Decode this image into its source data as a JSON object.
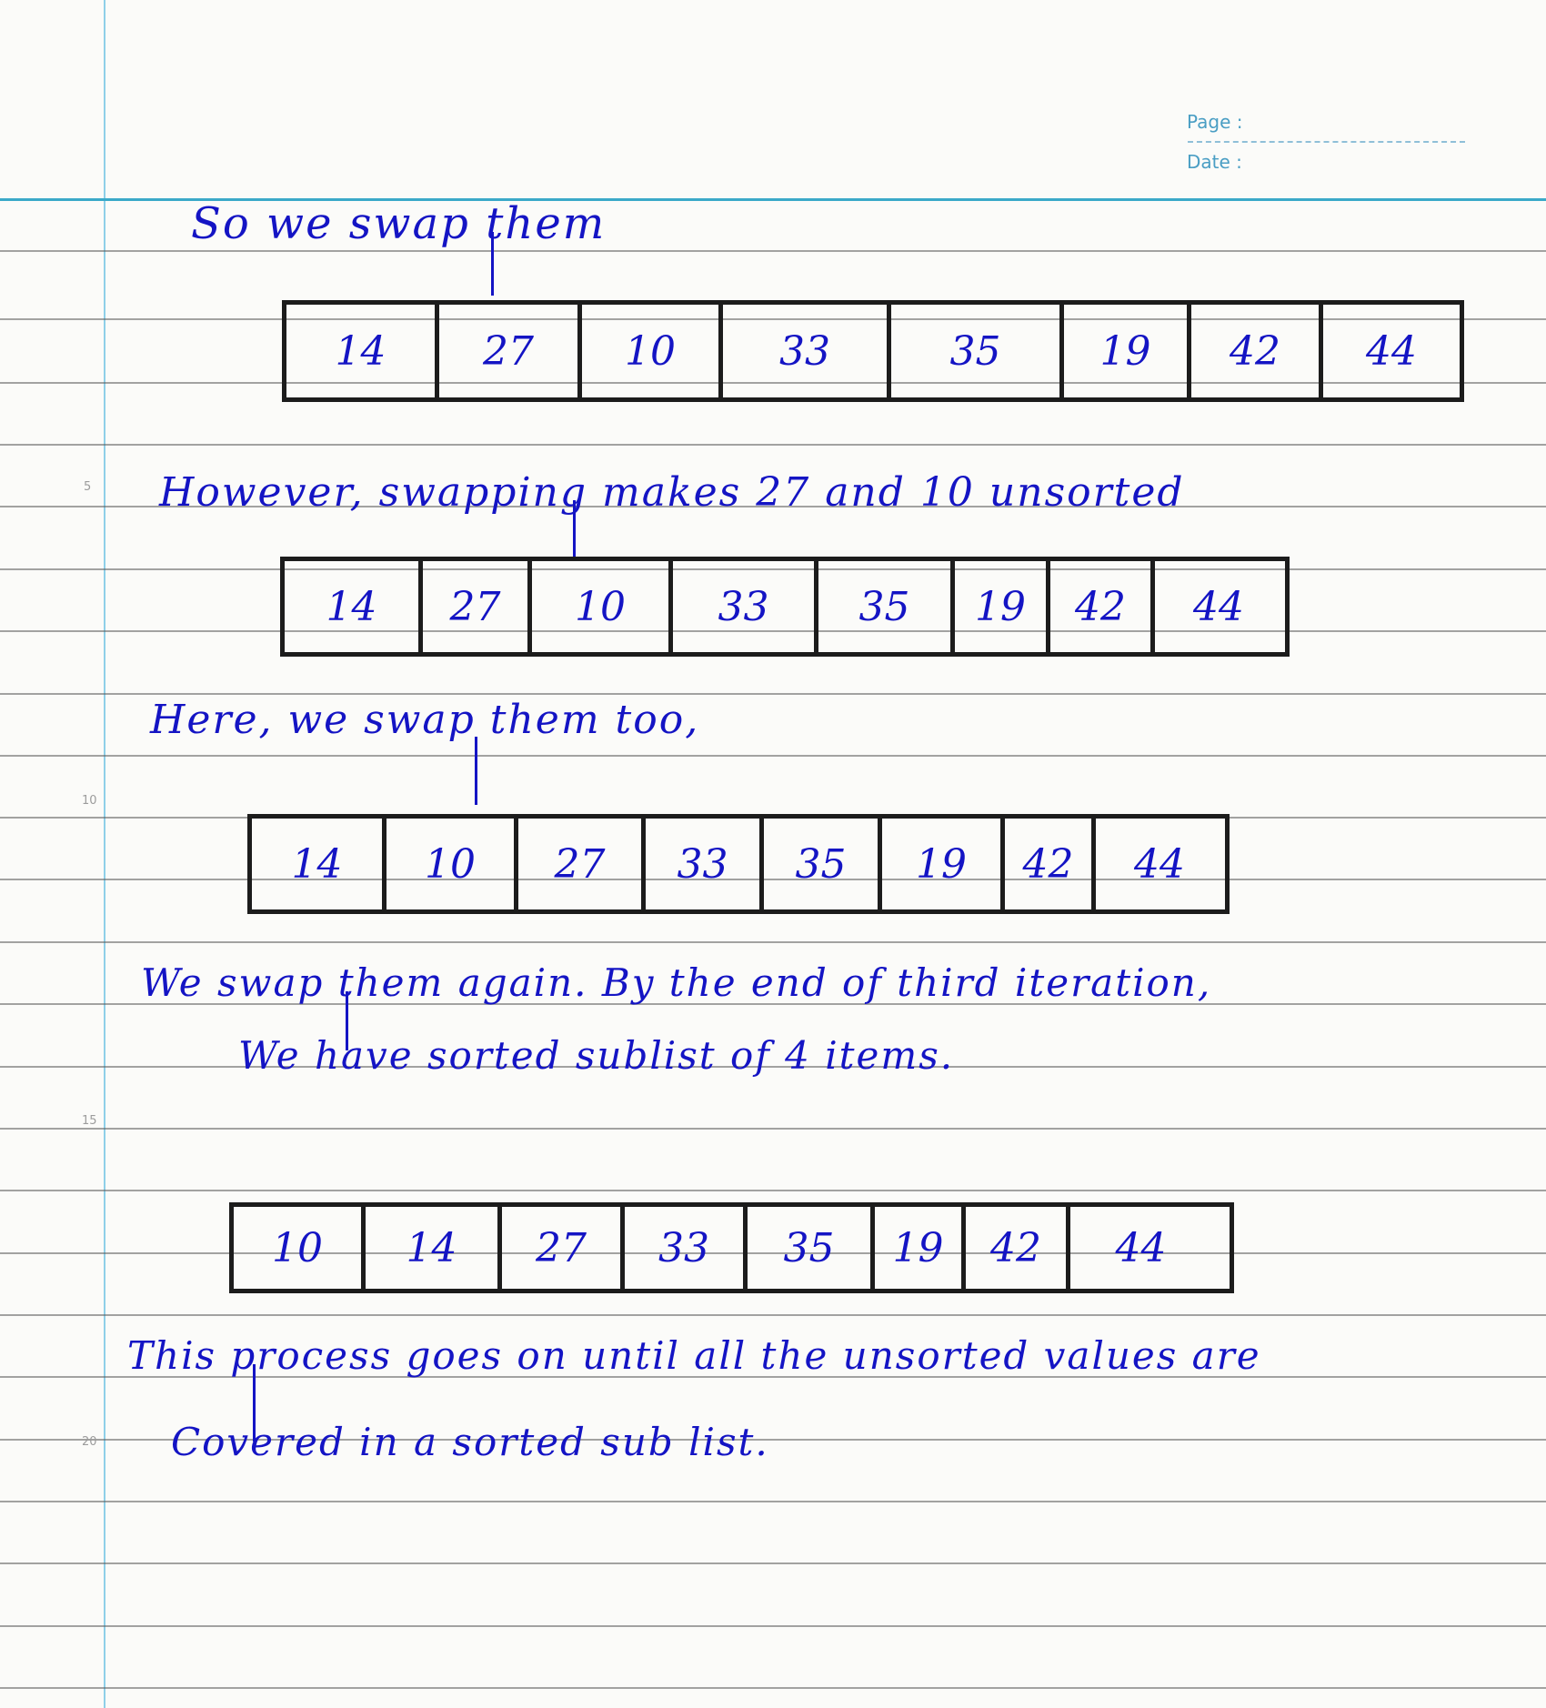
{
  "header": {
    "page_label": "Page :",
    "date_label": "Date :"
  },
  "margin_numbers": [
    "5",
    "10",
    "15",
    "20"
  ],
  "notes": {
    "line1": "So we swap them",
    "line2": "However, swapping makes 27 and 10 unsorted",
    "line3": "Here, we swap them too,",
    "line4": "We swap them again. By the end of third iteration,",
    "line5": "We have sorted sublist of 4 items.",
    "line6": "This process goes on until all the unsorted values are",
    "line7": "Covered in a sorted sub list."
  },
  "arrays": [
    {
      "cells": [
        "14",
        "27",
        "10",
        "33",
        "35",
        "19",
        "42",
        "44"
      ]
    },
    {
      "cells": [
        "14",
        "27",
        "10",
        "33",
        "35",
        "19",
        "42",
        "44"
      ]
    },
    {
      "cells": [
        "14",
        "10",
        "27",
        "33",
        "35",
        "19",
        "42",
        "44"
      ]
    },
    {
      "cells": [
        "10",
        "14",
        "27",
        "33",
        "35",
        "19",
        "42",
        "44"
      ]
    }
  ]
}
